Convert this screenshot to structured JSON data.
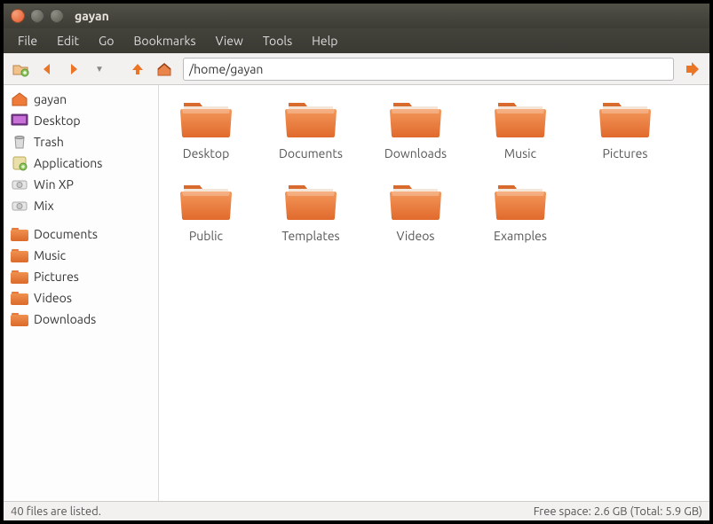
{
  "window_title": "gayan",
  "menu": [
    "File",
    "Edit",
    "Go",
    "Bookmarks",
    "View",
    "Tools",
    "Help"
  ],
  "path": "/home/gayan",
  "sidebar": {
    "places": [
      {
        "label": "gayan",
        "icon": "home"
      },
      {
        "label": "Desktop",
        "icon": "desktop"
      },
      {
        "label": "Trash",
        "icon": "trash"
      },
      {
        "label": "Applications",
        "icon": "apps"
      },
      {
        "label": "Win XP",
        "icon": "drive"
      },
      {
        "label": "Mix",
        "icon": "drive"
      }
    ],
    "bookmarks": [
      {
        "label": "Documents",
        "icon": "folder"
      },
      {
        "label": "Music",
        "icon": "folder"
      },
      {
        "label": "Pictures",
        "icon": "folder"
      },
      {
        "label": "Videos",
        "icon": "folder"
      },
      {
        "label": "Downloads",
        "icon": "folder"
      }
    ]
  },
  "folders": [
    "Desktop",
    "Documents",
    "Downloads",
    "Music",
    "Pictures",
    "Public",
    "Templates",
    "Videos",
    "Examples"
  ],
  "status_left": "40 files are listed.",
  "status_right": "Free space: 2.6 GB (Total: 5.9 GB)"
}
